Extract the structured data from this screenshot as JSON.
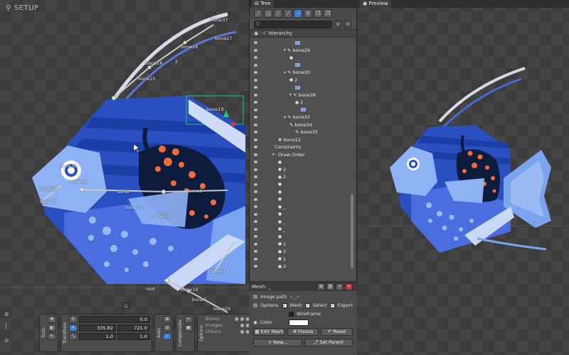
{
  "app": {
    "mode_label": "SETUP"
  },
  "tree_panel": {
    "tab_title": "Tree",
    "section": "Hierarchy",
    "rows": [
      {
        "label": "",
        "indent": 6,
        "kind": "mesh"
      },
      {
        "label": "bone29",
        "indent": 4,
        "kind": "bone",
        "expanded": true
      },
      {
        "label": "",
        "indent": 5,
        "kind": "slot"
      },
      {
        "label": "",
        "indent": 6,
        "kind": "mesh"
      },
      {
        "label": "bone30",
        "indent": 4,
        "kind": "bone",
        "expanded": true
      },
      {
        "label": "2",
        "indent": 5,
        "kind": "slot"
      },
      {
        "label": "",
        "indent": 6,
        "kind": "mesh"
      },
      {
        "label": "bone36",
        "indent": 5,
        "kind": "bone",
        "expanded": true
      },
      {
        "label": "2",
        "indent": 6,
        "kind": "slot"
      },
      {
        "label": "",
        "indent": 7,
        "kind": "mesh"
      },
      {
        "label": "bone33",
        "indent": 4,
        "kind": "bone",
        "expanded": true
      },
      {
        "label": "bone34",
        "indent": 5,
        "kind": "bone"
      },
      {
        "label": "bone35",
        "indent": 6,
        "kind": "bone"
      },
      {
        "label": "bone12",
        "indent": 3,
        "kind": "bone2"
      },
      {
        "label": "Constraints",
        "indent": 2,
        "kind": "constraint"
      },
      {
        "label": "Draw Order",
        "indent": 2,
        "kind": "draworder",
        "expanded": true
      },
      {
        "label": "",
        "indent": 3,
        "kind": "slot"
      },
      {
        "label": "2",
        "indent": 3,
        "kind": "slot"
      },
      {
        "label": "2",
        "indent": 3,
        "kind": "slot"
      },
      {
        "label": "",
        "indent": 3,
        "kind": "slot"
      },
      {
        "label": "",
        "indent": 3,
        "kind": "slot"
      },
      {
        "label": "",
        "indent": 3,
        "kind": "slot"
      },
      {
        "label": "_",
        "indent": 3,
        "kind": "slot"
      },
      {
        "label": "",
        "indent": 3,
        "kind": "slot"
      },
      {
        "label": "_",
        "indent": 3,
        "kind": "slot"
      },
      {
        "label": "_",
        "indent": 3,
        "kind": "slot"
      },
      {
        "label": "",
        "indent": 3,
        "kind": "slot"
      },
      {
        "label": "1",
        "indent": 3,
        "kind": "slot"
      },
      {
        "label": "2",
        "indent": 3,
        "kind": "slot"
      },
      {
        "label": "1",
        "indent": 3,
        "kind": "slot"
      },
      {
        "label": "2",
        "indent": 3,
        "kind": "slot"
      }
    ]
  },
  "mesh_panel": {
    "title": "Mesh: _",
    "image_path_label": "Image path",
    "image_path_value": "<_>",
    "options_label": "Options",
    "opt_mesh": "Mesh",
    "opt_select": "Select",
    "opt_export": "Export",
    "opt_wireframe": "Wireframe",
    "color_label": "Color",
    "edit_mesh": "Edit Mesh",
    "freeze": "Freeze",
    "reset": "Reset",
    "new": "New...",
    "set_parent": "Set Parent"
  },
  "preview": {
    "tab_title": "Preview"
  },
  "bottom_tools": {
    "tools_label": "Tools",
    "transform_label": "Transform",
    "axes_label": "Axes",
    "compensate_label": "Compensate",
    "options_label": "Options",
    "rotate_value": "0.0",
    "translate_x": "335.82",
    "translate_y": "721.0",
    "scale_x": "1.0",
    "scale_y": "1.0",
    "opt_bones": "Bones",
    "opt_images": "Images",
    "opt_others": "Others",
    "collapse": "_"
  },
  "bones": [
    {
      "name": "bone37"
    },
    {
      "name": "bone27"
    },
    {
      "name": "bone26"
    },
    {
      "name": "bone18"
    },
    {
      "name": "2"
    },
    {
      "name": "bone25"
    },
    {
      "name": "bone19"
    },
    {
      "name": "bone36"
    },
    {
      "name": "bone30"
    },
    {
      "name": "bone28"
    },
    {
      "name": "bone29"
    },
    {
      "name": "bone"
    },
    {
      "name": "bone2"
    },
    {
      "name": "bone33"
    },
    {
      "name": "bone34"
    },
    {
      "name": "bone9"
    },
    {
      "name": "root"
    },
    {
      "name": "bone19"
    },
    {
      "name": "bone5"
    },
    {
      "name": "bone20"
    },
    {
      "name": "bone21"
    }
  ],
  "colors": {
    "accent": "#3c7fd0",
    "fish_blue": "#2a4fc0",
    "fish_light": "#7aa4f0",
    "spot": "#f06a3a",
    "dark_body": "#0d1b3d"
  }
}
